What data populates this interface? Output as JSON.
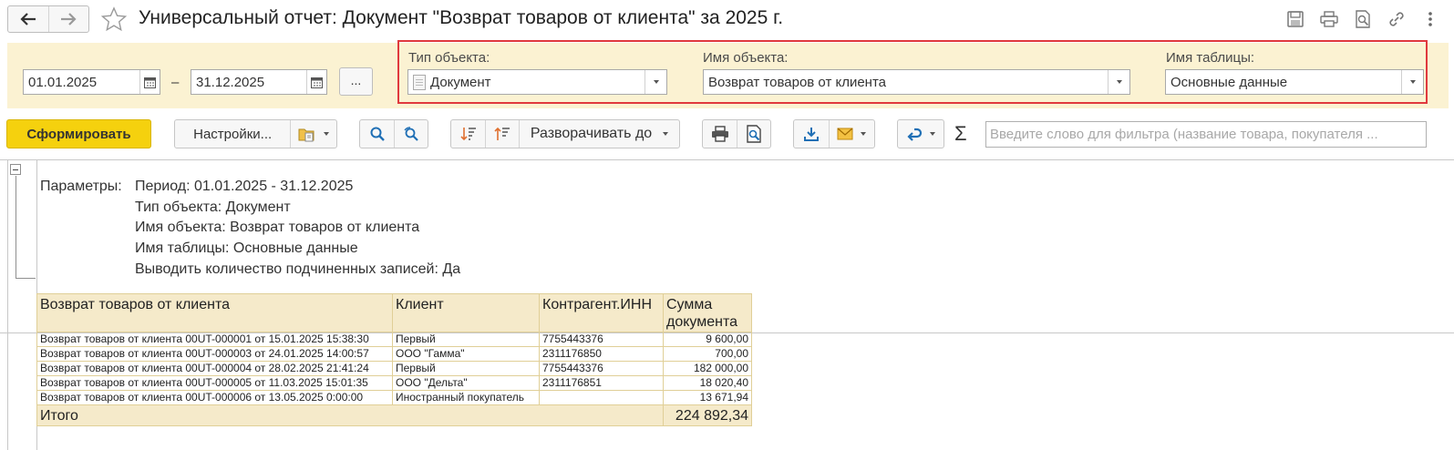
{
  "window": {
    "title": "Универсальный отчет: Документ \"Возврат товаров от клиента\" за 2025 г."
  },
  "period": {
    "start": "01.01.2025",
    "dash": "–",
    "end": "31.12.2025",
    "more_label": "..."
  },
  "object_params": {
    "type_label": "Тип объекта:",
    "type_value": "Документ",
    "name_label": "Имя объекта:",
    "name_value": "Возврат товаров от клиента",
    "table_label": "Имя таблицы:",
    "table_value": "Основные данные"
  },
  "toolbar": {
    "generate_label": "Сформировать",
    "settings_label": "Настройки...",
    "expand_label": "Разворачивать до",
    "sigma": "Σ",
    "filter_placeholder": "Введите слово для фильтра (название товара, покупателя ..."
  },
  "report": {
    "params_label": "Параметры:",
    "params_lines": [
      "Период: 01.01.2025 - 31.12.2025",
      "Тип объекта: Документ",
      "Имя объекта: Возврат товаров от клиента",
      "Имя таблицы: Основные данные",
      "Выводить количество подчиненных записей: Да"
    ],
    "columns": [
      "Возврат товаров от клиента",
      "Клиент",
      "Контрагент.ИНН",
      "Сумма документа"
    ],
    "rows": [
      [
        "Возврат товаров от клиента 00UT-000001 от 15.01.2025 15:38:30",
        "Первый",
        "7755443376",
        "9 600,00"
      ],
      [
        "Возврат товаров от клиента 00UT-000003 от 24.01.2025 14:00:57",
        "ООО \"Гамма\"",
        "2311176850",
        "700,00"
      ],
      [
        "Возврат товаров от клиента 00UT-000004 от 28.02.2025 21:41:24",
        "Первый",
        "7755443376",
        "182 000,00"
      ],
      [
        "Возврат товаров от клиента 00UT-000005 от 11.03.2025 15:01:35",
        "ООО \"Дельта\"",
        "2311176851",
        "18 020,40"
      ],
      [
        "Возврат товаров от клиента 00UT-000006 от 13.05.2025 0:00:00",
        "Иностранный покупатель",
        "",
        "13 671,94"
      ]
    ],
    "total_label": "Итого",
    "total_value": "224 892,34"
  },
  "colors": {
    "params_bg": "#fbf2d2",
    "primary_button": "#f5d10e",
    "highlight_border": "#e0393e",
    "table_header_bg": "#f5eaca",
    "icon_blue": "#1f6fb5"
  }
}
